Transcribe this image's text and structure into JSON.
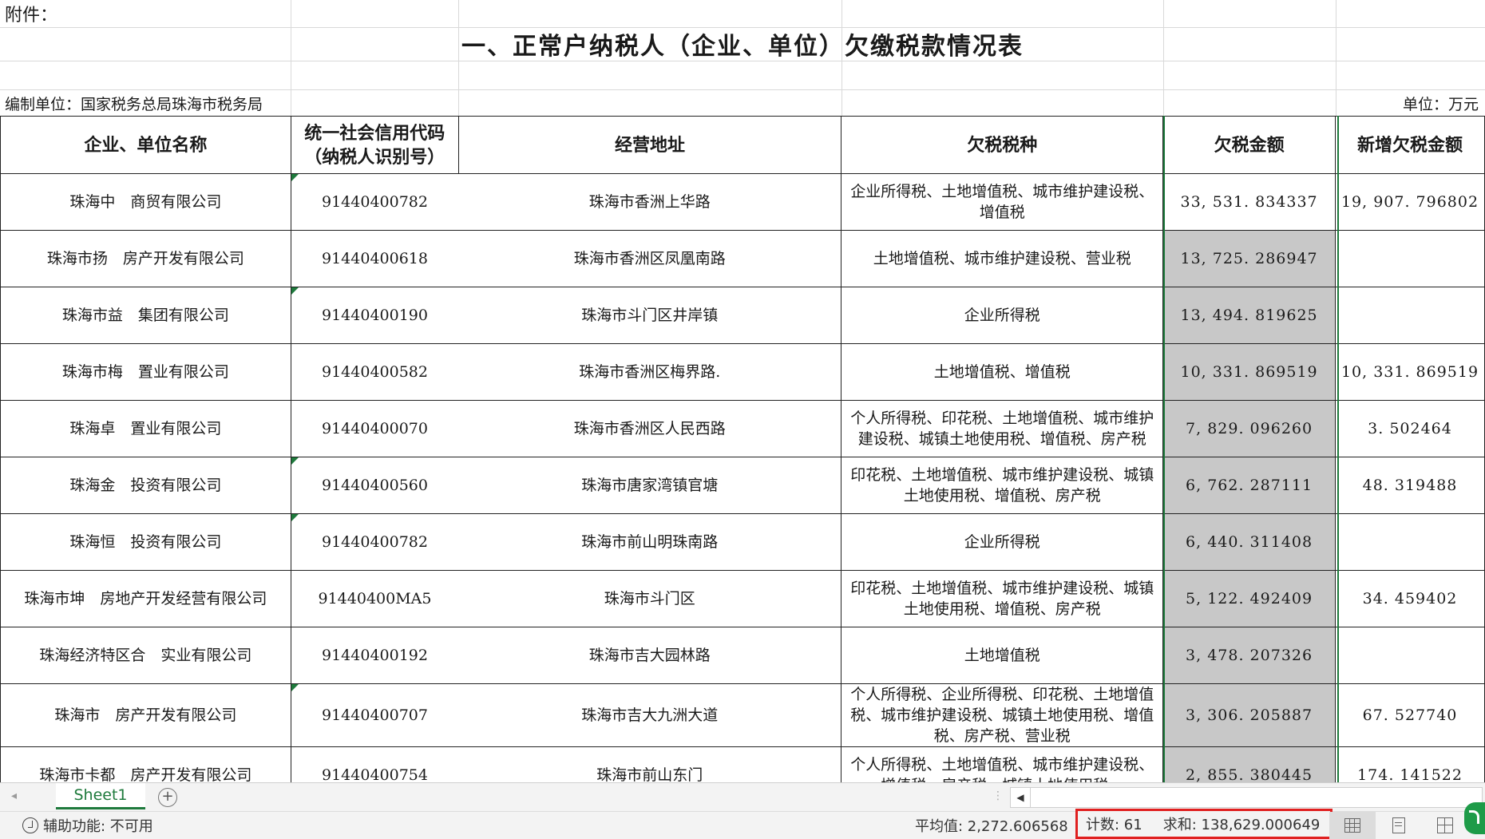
{
  "sheet": {
    "attachment_label": "附件：",
    "title": "一、正常户纳税人（企业、单位）欠缴税款情况表",
    "compiler": "编制单位：国家税务总局珠海市税务局",
    "unit": "单位：万元"
  },
  "table": {
    "headers": [
      "企业、单位名称",
      "统一社会信用代码（纳税人识别号）",
      "经营地址",
      "欠税税种",
      "欠税金额",
      "新增欠税金额"
    ],
    "rows": [
      {
        "name": "珠海中　商贸有限公司",
        "code": "91440400782",
        "address": "珠海市香洲上华路",
        "taxes": "企业所得税、土地增值税、城市维护建设税、增值税",
        "amount": "33, 531. 834337",
        "new_amount": "19, 907. 796802"
      },
      {
        "name": "珠海市扬　房产开发有限公司",
        "code": "91440400618",
        "address": "珠海市香洲区凤凰南路",
        "taxes": "土地增值税、城市维护建设税、营业税",
        "amount": "13, 725. 286947",
        "new_amount": ""
      },
      {
        "name": "珠海市益　集团有限公司",
        "code": "91440400190",
        "address": "珠海市斗门区井岸镇",
        "taxes": "企业所得税",
        "amount": "13, 494. 819625",
        "new_amount": ""
      },
      {
        "name": "珠海市梅　置业有限公司",
        "code": "91440400582",
        "address": "珠海市香洲区梅界路.",
        "taxes": "土地增值税、增值税",
        "amount": "10, 331. 869519",
        "new_amount": "10, 331. 869519"
      },
      {
        "name": "珠海卓　置业有限公司",
        "code": "91440400070",
        "address": "珠海市香洲区人民西路",
        "taxes": "个人所得税、印花税、土地增值税、城市维护建设税、城镇土地使用税、增值税、房产税",
        "amount": "7, 829. 096260",
        "new_amount": "3. 502464"
      },
      {
        "name": "珠海金　投资有限公司",
        "code": "91440400560",
        "address": "珠海市唐家湾镇官塘",
        "taxes": "印花税、土地增值税、城市维护建设税、城镇土地使用税、增值税、房产税",
        "amount": "6, 762. 287111",
        "new_amount": "48. 319488"
      },
      {
        "name": "珠海恒　投资有限公司",
        "code": "91440400782",
        "address": "珠海市前山明珠南路",
        "taxes": "企业所得税",
        "amount": "6, 440. 311408",
        "new_amount": ""
      },
      {
        "name": "珠海市坤　房地产开发经营有限公司",
        "code": "91440400MA5",
        "address": "珠海市斗门区",
        "taxes": "印花税、土地增值税、城市维护建设税、城镇土地使用税、增值税、房产税",
        "amount": "5, 122. 492409",
        "new_amount": "34. 459402"
      },
      {
        "name": "珠海经济特区合　实业有限公司",
        "code": "91440400192",
        "address": "珠海市吉大园林路",
        "taxes": "土地增值税",
        "amount": "3, 478. 207326",
        "new_amount": ""
      },
      {
        "name": "珠海市𡅀　房产开发有限公司",
        "code": "91440400707",
        "address": "珠海市吉大九洲大道",
        "taxes": "个人所得税、企业所得税、印花税、土地增值税、城市维护建设税、城镇土地使用税、增值税、房产税、营业税",
        "amount": "3, 306. 205887",
        "new_amount": "67. 527740"
      },
      {
        "name": "珠海市卡都　房产开发有限公司",
        "code": "91440400754",
        "address": "珠海市前山东门",
        "taxes": "个人所得税、土地增值税、城市维护建设税、增值税、房产税、城镇土地使用税、",
        "amount": "2, 855. 380445",
        "new_amount": "174. 141522"
      }
    ]
  },
  "tabs": {
    "sheet_name": "Sheet1",
    "add_icon": "plus-circle-icon"
  },
  "status": {
    "accessibility": "辅助功能: 不可用",
    "average": "平均值: 2,272.606568",
    "count": "计数: 61",
    "sum": "求和: 138,629.000649"
  },
  "colors": {
    "accent": "#1e7a3c",
    "highlight_border": "#e02020",
    "selected_fill": "#c8c8c8"
  }
}
